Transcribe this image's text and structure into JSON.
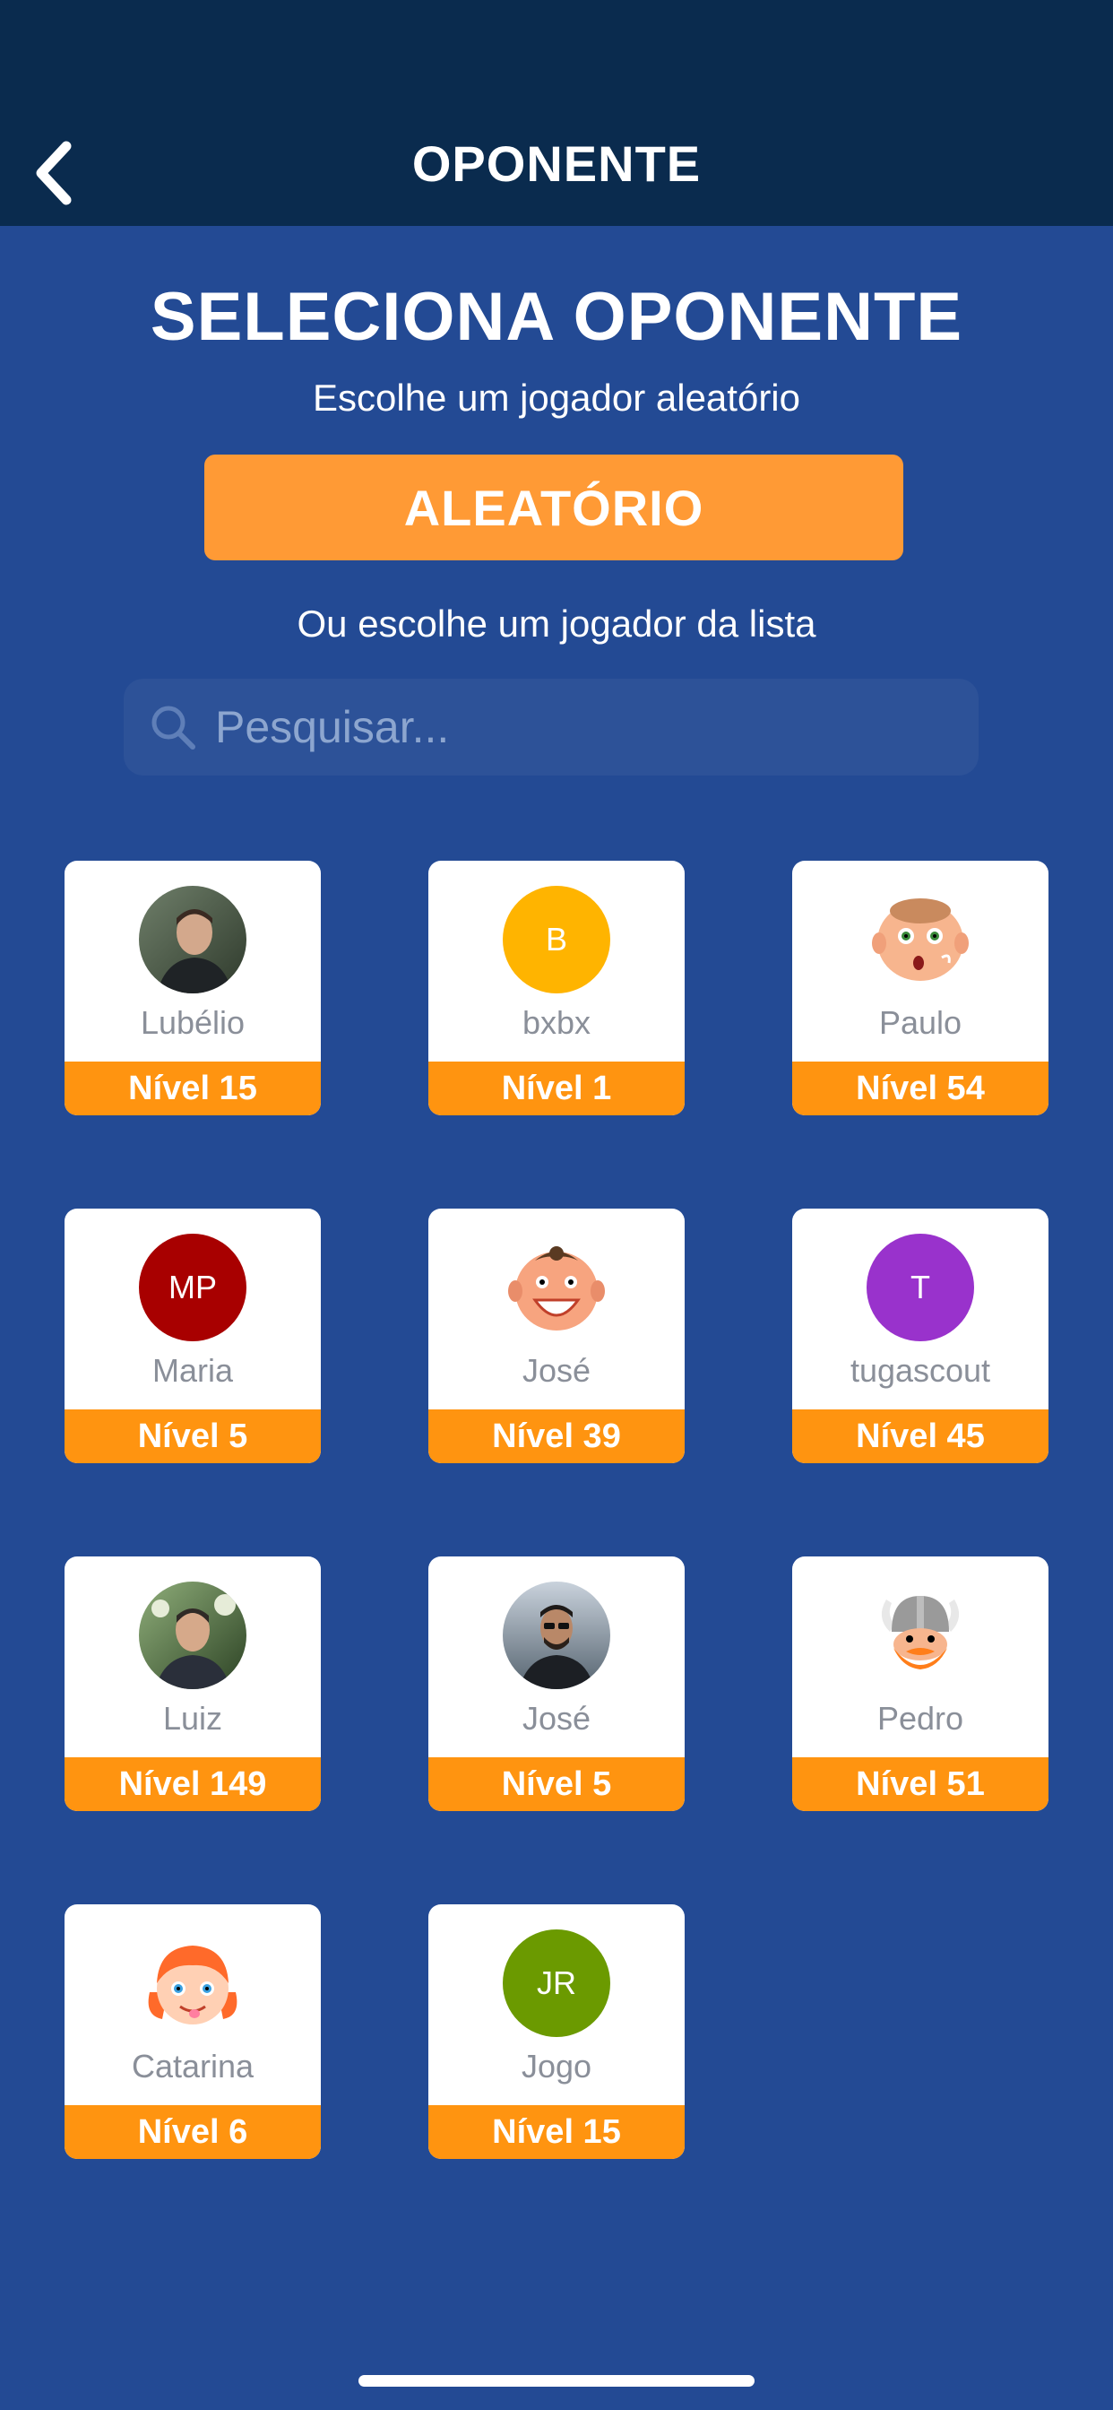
{
  "header": {
    "title": "OPONENTE",
    "back_icon": "chevron-left-icon"
  },
  "main": {
    "heading": "SELECIONA OPONENTE",
    "subheading": "Escolhe um jogador aleatório",
    "random_button": "ALEATÓRIO",
    "list_caption": "Ou escolhe um jogador da lista",
    "search": {
      "placeholder": "Pesquisar...",
      "value": ""
    }
  },
  "colors": {
    "header_bg": "#0a2b4e",
    "page_bg": "#234a94",
    "accent_orange": "#ff9410",
    "button_orange": "#ff9a35"
  },
  "players": [
    {
      "name": "Lubélio",
      "level": "Nível 15",
      "avatar": "photo-avatar",
      "initials": "",
      "color": "#4a5a48"
    },
    {
      "name": "bxbx",
      "level": "Nível 1",
      "avatar": "initials-avatar",
      "initials": "B",
      "color": "#ffb400"
    },
    {
      "name": "Paulo",
      "level": "Nível 54",
      "avatar": "cartoon-baby-face-icon",
      "initials": "",
      "color": "#f7b58e"
    },
    {
      "name": "Maria",
      "level": "Nível 5",
      "avatar": "initials-avatar",
      "initials": "MP",
      "color": "#a80000"
    },
    {
      "name": "José",
      "level": "Nível 39",
      "avatar": "cartoon-laughing-face-icon",
      "initials": "",
      "color": "#f7a47f"
    },
    {
      "name": "tugascout",
      "level": "Nível 45",
      "avatar": "initials-avatar",
      "initials": "T",
      "color": "#9932cc"
    },
    {
      "name": "Luiz",
      "level": "Nível 149",
      "avatar": "photo-avatar",
      "initials": "",
      "color": "#3d5a32"
    },
    {
      "name": "José",
      "level": "Nível 5",
      "avatar": "photo-avatar",
      "initials": "",
      "color": "#5a6a7a"
    },
    {
      "name": "Pedro",
      "level": "Nível 51",
      "avatar": "cartoon-viking-icon",
      "initials": "",
      "color": "#ff7e1a"
    },
    {
      "name": "Catarina",
      "level": "Nível 6",
      "avatar": "cartoon-girl-face-icon",
      "initials": "",
      "color": "#ff6a2a"
    },
    {
      "name": "Jogo",
      "level": "Nível 15",
      "avatar": "initials-avatar",
      "initials": "JR",
      "color": "#6b9a00"
    }
  ]
}
